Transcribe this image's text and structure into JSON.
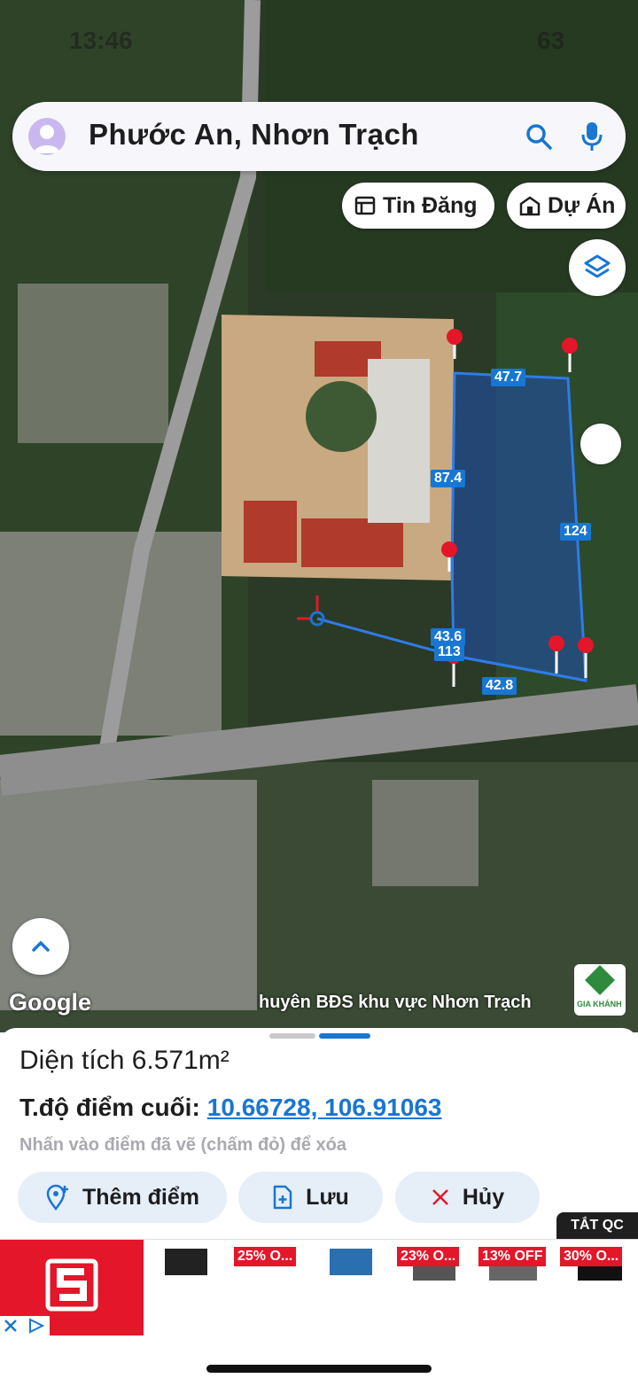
{
  "status": {
    "time": "13:46",
    "battery": "63"
  },
  "search": {
    "text": "Phước An, Nhơn Trạch"
  },
  "chips": {
    "listings_label": "Tin Đăng",
    "projects_label": "Dự Án"
  },
  "map": {
    "measurements": [
      "47.7",
      "87.4",
      "124",
      "43.6",
      "113",
      "42.8"
    ],
    "google_label": "Google",
    "watermark_text": "huyên BĐS khu vực Nhơn Trạch",
    "logo_text": "GIA KHÁNH"
  },
  "sheet": {
    "area_text": "Diện tích 6.571m²",
    "coord_label": "T.độ điểm cuối:",
    "coord_value": "10.66728, 106.91063",
    "hint": "Nhấn vào điểm đã vẽ (chấm đỏ) để xóa",
    "add_point_label": "Thêm điểm",
    "save_label": "Lưu",
    "cancel_label": "Hủy"
  },
  "ad": {
    "close_label": "TẮT QC",
    "badges": [
      "25% O...",
      "23% O...",
      "13% OFF",
      "30% O..."
    ]
  },
  "colors": {
    "accent": "#1976d2",
    "plot_fill": "#1e4fa8",
    "pin": "#e3162a"
  }
}
